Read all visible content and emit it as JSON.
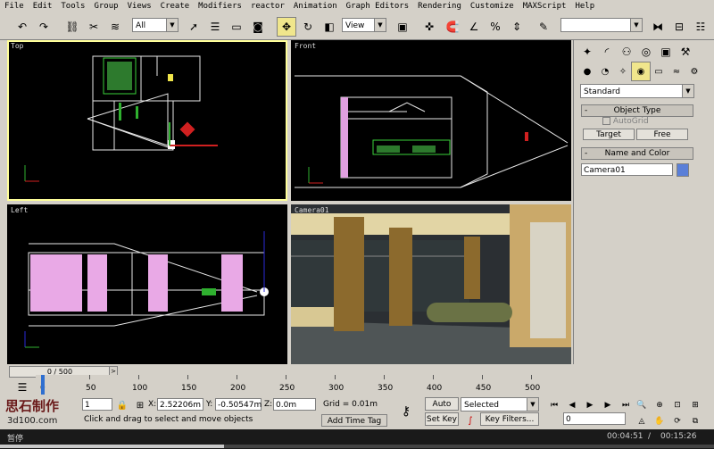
{
  "menu": [
    "File",
    "Edit",
    "Tools",
    "Group",
    "Views",
    "Create",
    "Modifiers",
    "reactor",
    "Animation",
    "Graph Editors",
    "Rendering",
    "Customize",
    "MAXScript",
    "Help"
  ],
  "toolbar": {
    "selection_filter": "All",
    "reference_coord": "View"
  },
  "viewports": {
    "top": "Top",
    "front": "Front",
    "left": "Left",
    "camera": "Camera01"
  },
  "command_panel": {
    "category": "Standard",
    "object_type_title": "Object Type",
    "autogrid": "AutoGrid",
    "target_button": "Target",
    "free_button": "Free",
    "name_color_title": "Name and Color",
    "object_name": "Camera01",
    "object_color": "#5a7fd8"
  },
  "timeline": {
    "slider_label": "0 / 500",
    "ticks": [
      "0",
      "50",
      "100",
      "150",
      "200",
      "250",
      "300",
      "350",
      "400",
      "450",
      "500"
    ]
  },
  "status": {
    "selection_count": "1 Came",
    "x_label": "X:",
    "x_value": "2.52206m",
    "y_label": "Y:",
    "y_value": "-0.50547m",
    "z_label": "Z:",
    "z_value": "0.0m",
    "grid": "Grid = 0.01m",
    "prompt": "Click and drag to select and move objects",
    "add_time_tag": "Add Time Tag",
    "auto_key": "Auto Key",
    "set_key": "Set Key",
    "key_mode": "Selected",
    "key_filters": "Key Filters...",
    "frame": "0"
  },
  "overlay": {
    "watermark_logo": "思石制作",
    "watermark_site": "3d100.com",
    "playback_status": "暂停",
    "time_current": "00:04:51",
    "time_total": "00:15:26"
  }
}
